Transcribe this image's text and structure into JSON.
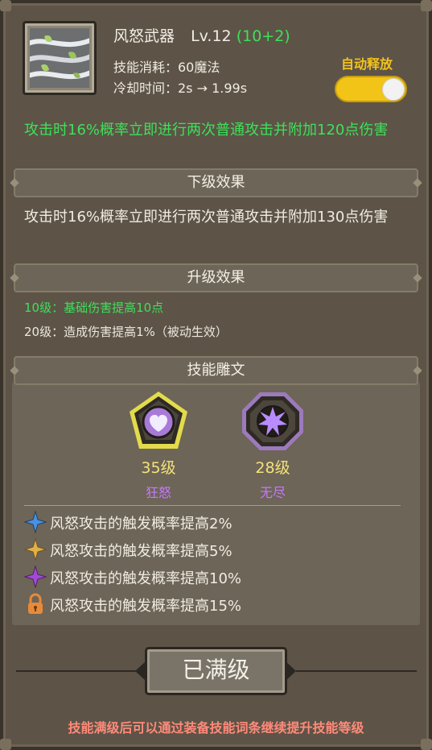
{
  "skill": {
    "name": "风怒武器",
    "level": "Lv.12",
    "level_bonus": "(10+2)",
    "cost": "技能消耗：60魔法",
    "cooldown": "冷却时间：2s → 1.99s",
    "icon": "wind-leaves-icon"
  },
  "auto_cast": {
    "label": "自动释放",
    "enabled": true
  },
  "current_effect": "攻击时16%概率立即进行两次普通攻击并附加120点伤害",
  "next_level": {
    "header": "下级效果",
    "text": "攻击时16%概率立即进行两次普通攻击并附加130点伤害"
  },
  "upgrade": {
    "header": "升级效果",
    "items": [
      "10级：基础伤害提高10点",
      "20级：造成伤害提高1%（被动生效）"
    ]
  },
  "runes": {
    "header": "技能雕文",
    "slots": [
      {
        "level": "35级",
        "name": "狂怒",
        "icon": "heart-icon"
      },
      {
        "level": "28级",
        "name": "无尽",
        "icon": "burst-icon"
      }
    ],
    "effects": [
      {
        "text": "风怒攻击的触发概率提高2%",
        "icon": "blue-star-icon",
        "color": "#4a90e2"
      },
      {
        "text": "风怒攻击的触发概率提高5%",
        "icon": "gold-star-icon",
        "color": "#e2b04a"
      },
      {
        "text": "风怒攻击的触发概率提高10%",
        "icon": "purple-star-icon",
        "color": "#a24ad8"
      },
      {
        "text": "风怒攻击的触发概率提高15%",
        "icon": "lock-icon",
        "color": "#e88a3a"
      }
    ]
  },
  "button": {
    "label": "已满级"
  },
  "footer": "技能满级后可以通过装备技能词条继续提升技能等级",
  "colors": {
    "green": "#3ee05a",
    "toggle": "#f1c417",
    "purple": "#c678ff",
    "footer": "#ff8a7a"
  }
}
